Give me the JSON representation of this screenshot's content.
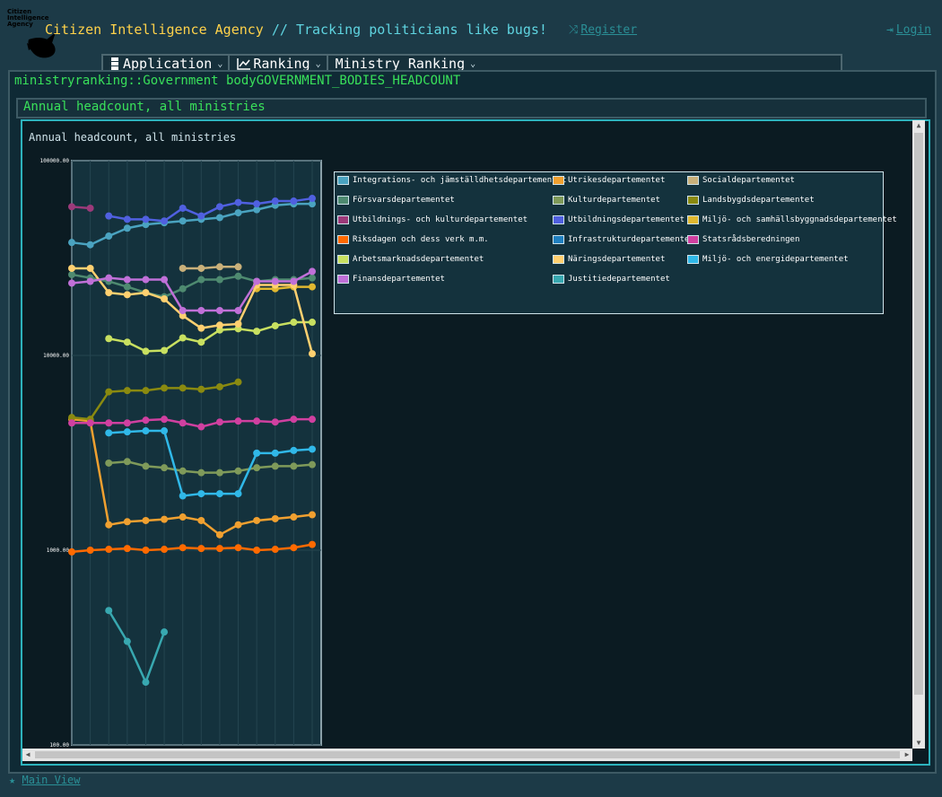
{
  "header": {
    "logo_text": "Citizen Intelligence Agency",
    "site_name": "Citizen Intelligence Agency",
    "tagline": " // Tracking politicians like bugs!",
    "register_label": "Register",
    "login_label": "Login"
  },
  "menu": [
    {
      "label": "Application",
      "icon": "server-icon"
    },
    {
      "label": "Ranking",
      "icon": "chart-line-icon"
    },
    {
      "label": "Ministry Ranking",
      "icon": ""
    }
  ],
  "page": {
    "heading": "ministryranking::Government bodyGOVERNMENT_BODIES_HEADCOUNT",
    "section_title": "Annual headcount, all ministries"
  },
  "chart_data": {
    "type": "line",
    "title": "Annual headcount, all ministries",
    "y_scale": "log",
    "ylim": [
      100,
      100000
    ],
    "y_ticks": [
      "100000.00",
      "10000.00",
      "1000.00",
      "100.00"
    ],
    "grid": true,
    "legend_position": "right",
    "x": [
      0,
      1,
      2,
      3,
      4,
      5,
      6,
      7,
      8,
      9,
      10,
      11,
      12,
      13
    ],
    "series": [
      {
        "name": "Integrations- och jämställdhetsdepartementet",
        "color": "#4aa3c0",
        "values": [
          38000,
          37000,
          41000,
          45000,
          47000,
          48000,
          49000,
          50000,
          51000,
          54000,
          56000,
          59000,
          60000,
          60000
        ]
      },
      {
        "name": "Utrikesdepartementet",
        "color": "#f0a030",
        "values": [
          4700,
          4600,
          1350,
          1400,
          1420,
          1440,
          1480,
          1420,
          1200,
          1350,
          1420,
          1450,
          1480,
          1520
        ]
      },
      {
        "name": "Socialdepartementet",
        "color": "#c9b07a",
        "values": [
          null,
          null,
          null,
          null,
          null,
          null,
          28000,
          28000,
          28500,
          28500,
          null,
          null,
          null,
          null
        ]
      },
      {
        "name": "Försvarsdepartementet",
        "color": "#4e8a70",
        "values": [
          26000,
          25000,
          24000,
          22500,
          21000,
          20000,
          22000,
          24500,
          24500,
          25500,
          24000,
          24500,
          24500,
          25000
        ]
      },
      {
        "name": "Kulturdepartementet",
        "color": "#7f9a5a",
        "values": [
          null,
          null,
          2800,
          2850,
          2700,
          2650,
          2550,
          2500,
          2500,
          2550,
          2650,
          2700,
          2700,
          2750
        ]
      },
      {
        "name": "Landsbygdsdepartementet",
        "color": "#8a8a10",
        "values": [
          4800,
          4700,
          6500,
          6600,
          6600,
          6800,
          6800,
          6700,
          6900,
          7300,
          null,
          null,
          null,
          null
        ]
      },
      {
        "name": "Utbildnings- och kulturdepartementet",
        "color": "#9c3a7a",
        "values": [
          58000,
          57000,
          null,
          null,
          null,
          null,
          null,
          null,
          null,
          null,
          null,
          null,
          null,
          null
        ]
      },
      {
        "name": "Utbildningsdepartementet",
        "color": "#5060e0",
        "values": [
          null,
          null,
          52000,
          50000,
          50000,
          49000,
          57000,
          52000,
          58000,
          61000,
          60000,
          62000,
          62000,
          64000
        ]
      },
      {
        "name": "Miljö- och samhällsbyggnadsdepartementet",
        "color": "#e0b830",
        "values": [
          null,
          null,
          null,
          null,
          null,
          null,
          null,
          null,
          null,
          null,
          22000,
          22000,
          22500,
          22500
        ]
      },
      {
        "name": "Riksdagen och dess verk m.m.",
        "color": "#ff6a00",
        "values": [
          980,
          1000,
          1010,
          1020,
          1000,
          1010,
          1030,
          1020,
          1020,
          1030,
          1000,
          1010,
          1030,
          1070
        ]
      },
      {
        "name": "Infrastrukturdepartementet",
        "color": "#2080c0",
        "values": [
          null,
          null,
          null,
          null,
          null,
          null,
          null,
          null,
          null,
          null,
          null,
          null,
          null,
          null
        ]
      },
      {
        "name": "Statsrådsberedningen",
        "color": "#d040a0",
        "values": [
          4500,
          4500,
          4500,
          4500,
          4650,
          4700,
          4500,
          4300,
          4550,
          4600,
          4600,
          4550,
          4700,
          4700
        ]
      },
      {
        "name": "Arbetsmarknadsdepartementet",
        "color": "#c8e060",
        "values": [
          null,
          null,
          12200,
          11700,
          10500,
          10600,
          12300,
          11700,
          13500,
          13700,
          13300,
          14200,
          14800,
          14800
        ]
      },
      {
        "name": "Näringsdepartementet",
        "color": "#ffd070",
        "values": [
          28000,
          28000,
          21000,
          20500,
          21000,
          19500,
          16000,
          13800,
          14300,
          14500,
          23000,
          23000,
          23000,
          10200
        ]
      },
      {
        "name": "Miljö- och energidepartementet",
        "color": "#30b8e8",
        "values": [
          null,
          null,
          4000,
          4050,
          4100,
          4100,
          1900,
          1950,
          1950,
          1950,
          3150,
          3150,
          3250,
          3300
        ]
      },
      {
        "name": "Finansdepartementet",
        "color": "#c070d8",
        "values": [
          23500,
          24000,
          25000,
          24500,
          24500,
          24500,
          17000,
          17000,
          17000,
          17000,
          24000,
          24000,
          24000,
          27000
        ]
      },
      {
        "name": "Justitiedepartementet",
        "color": "#38a8b0",
        "values": [
          null,
          null,
          490,
          340,
          210,
          380,
          null,
          null,
          null,
          null,
          null,
          null,
          null,
          null
        ]
      }
    ]
  },
  "legend_columns": [
    [
      0,
      3,
      6,
      9,
      12,
      15
    ],
    [
      1,
      4,
      7,
      10,
      13,
      16
    ],
    [
      2,
      5,
      8,
      11,
      14
    ]
  ],
  "footer": {
    "main_view_label": "Main View"
  }
}
